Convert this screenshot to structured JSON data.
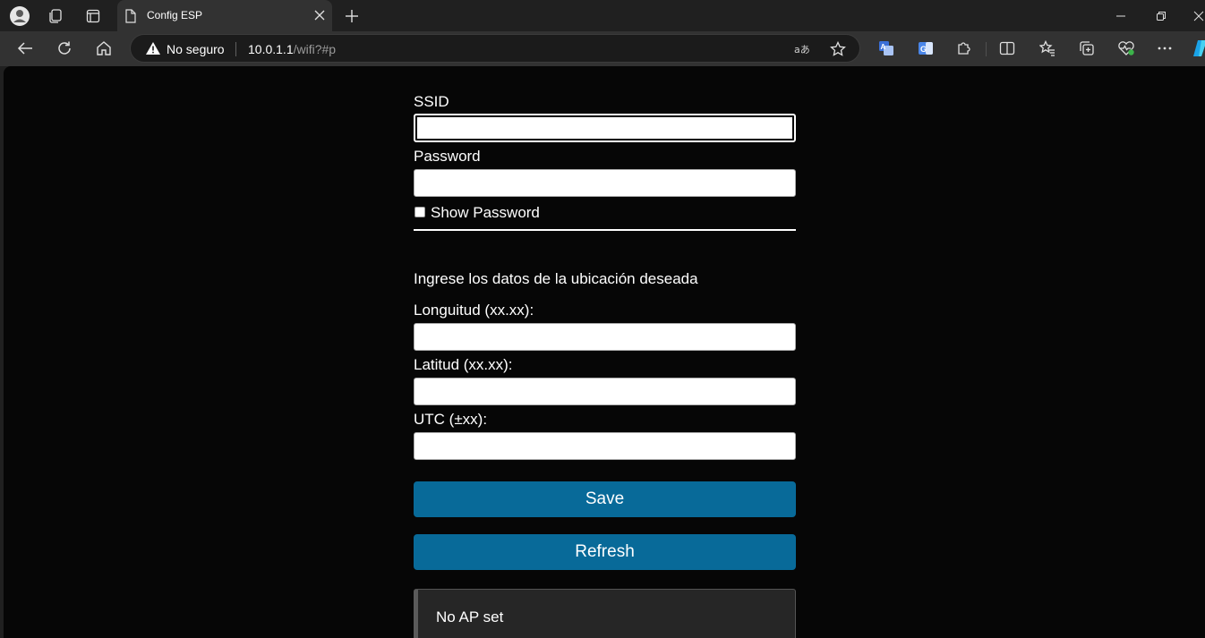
{
  "browser": {
    "tab": {
      "title": "Config ESP"
    },
    "address": {
      "security_label": "No seguro",
      "host": "10.0.1.1",
      "path": "/wifi?#p"
    },
    "icons": {
      "profile": "profile-icon",
      "workspaces": "workspaces-icon",
      "tab_actions": "tab-actions-icon",
      "page": "page-icon",
      "close_tab": "close-icon",
      "new_tab": "plus-icon",
      "back": "back-arrow-icon",
      "refresh": "refresh-icon",
      "home": "home-icon",
      "warning": "warning-icon",
      "read_aloud": "read-aloud-icon",
      "favorite": "star-icon",
      "translate": "translate-icon",
      "extensions": "puzzle-icon",
      "split_screen": "split-screen-icon",
      "favorites": "favorites-icon",
      "collections": "collections-icon",
      "performance": "heart-pulse-icon",
      "more": "more-icon",
      "copilot": "copilot-icon"
    }
  },
  "form": {
    "ssid_label": "SSID",
    "ssid_value": "",
    "password_label": "Password",
    "password_value": "",
    "show_password_label": "Show Password",
    "show_password_checked": false,
    "location_intro": "Ingrese los datos de la ubicación deseada",
    "longitude_label": "Longuitud (xx.xx):",
    "longitude_value": "",
    "latitude_label": "Latitud (xx.xx):",
    "latitude_value": "",
    "utc_label": "UTC (±xx):",
    "utc_value": "",
    "save_label": "Save",
    "refresh_label": "Refresh",
    "status_message": "No AP set"
  },
  "colors": {
    "page_bg": "#060606",
    "button": "#086a99",
    "chrome_bg": "#202020",
    "toolbar_bg": "#323232"
  }
}
